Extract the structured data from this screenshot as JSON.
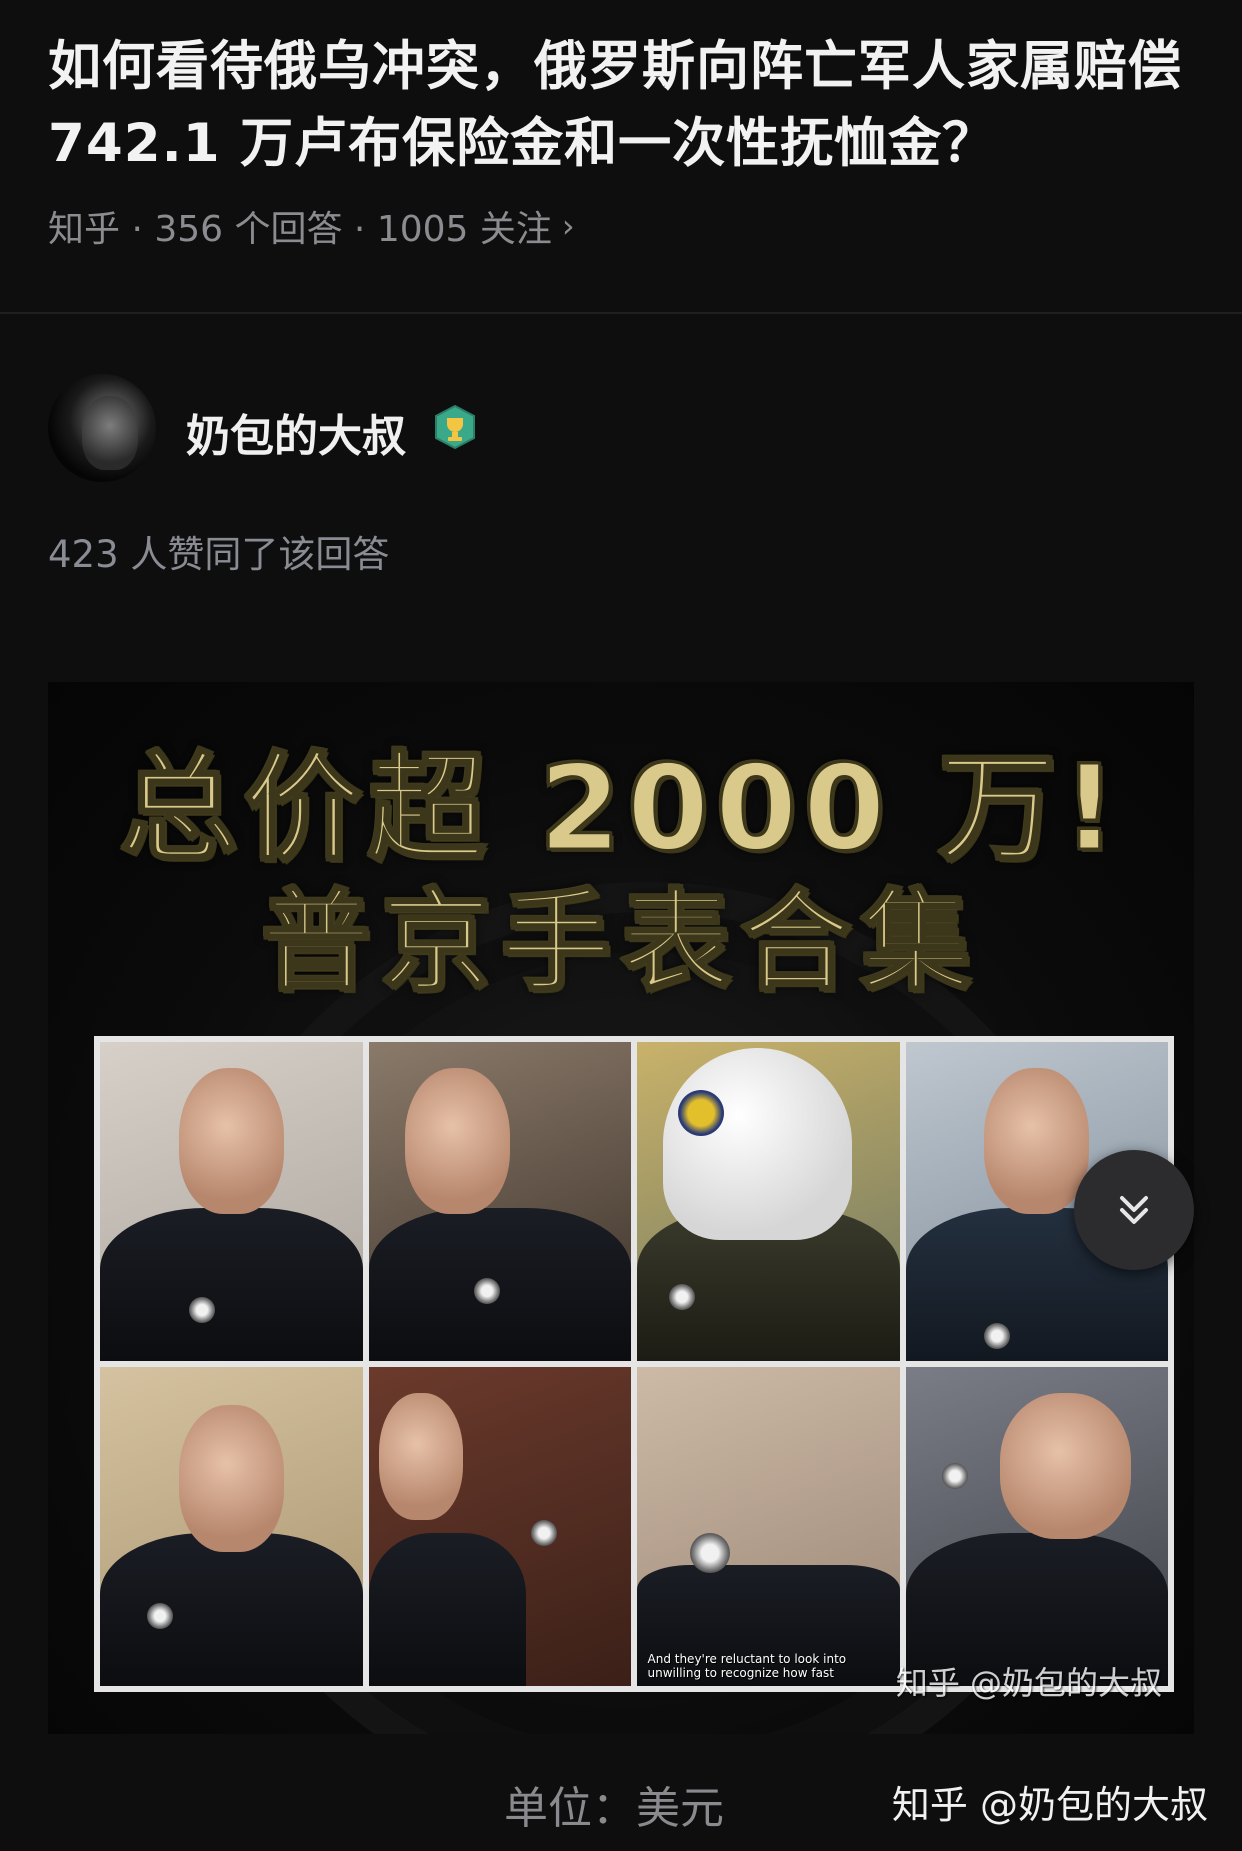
{
  "question": {
    "title": "如何看待俄乌冲突，俄罗斯向阵亡军人家属赔偿 742.1 万卢布保险金和一次性抚恤金？",
    "meta": "知乎 · 356 个回答 · 1005 关注"
  },
  "answer": {
    "author_name": "奶包的大叔",
    "author_badge_icon": "trophy-badge-icon",
    "vote_text": "423 人赞同了该回答"
  },
  "image": {
    "headline_line1": "总价超 2000 万!",
    "headline_line2": "普京手表合集",
    "cell7_caption": "And they're reluctant to look into unwilling to recognize how fast",
    "watermark": "知乎 @奶包的大叔"
  },
  "unit_text": "单位：美元",
  "page_watermark": "知乎 @奶包的大叔",
  "colors": {
    "background": "#0e0e0f",
    "headline_gold": "#d9c98a",
    "meta_gray": "#8c8c90"
  }
}
